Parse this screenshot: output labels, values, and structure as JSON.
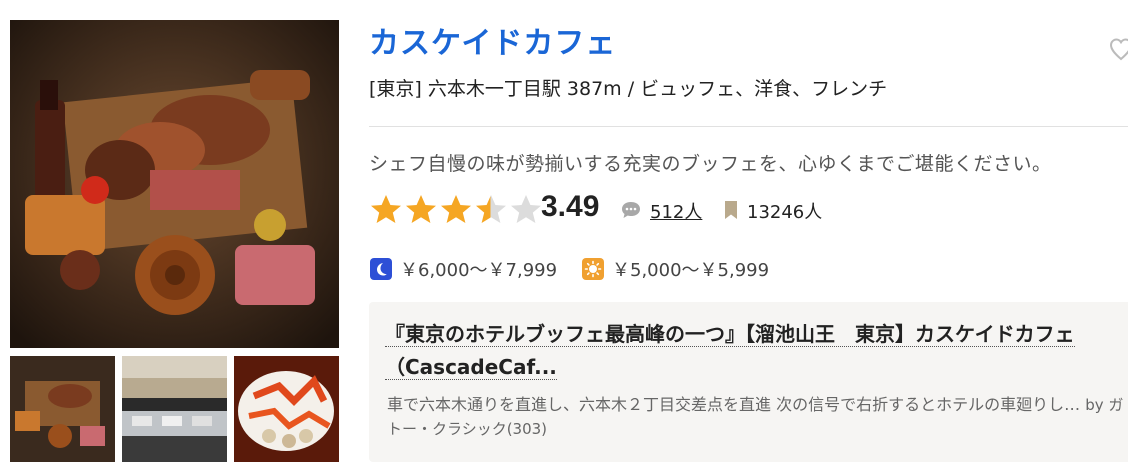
{
  "restaurant": {
    "name": "カスケイドカフェ",
    "meta": "[東京] 六本木一丁目駅 387m / ビュッフェ、洋食、フレンチ",
    "catchcopy": "シェフ自慢の味が勢揃いする充実のブッフェを、心ゆくまでご堪能ください。",
    "rating": {
      "score": "3.49",
      "stars_filled_fraction": 0.698,
      "star_color": "#f5a623"
    },
    "review_count": "512人",
    "bookmark_count": "13246人",
    "prices": {
      "dinner": "￥6,000～￥7,999",
      "lunch": "￥5,000～￥5,999"
    },
    "featured_review": {
      "title": "『東京のホテルブッフェ最高峰の一つ』【溜池山王　東京】カスケイドカフェ（CascadeCaf...",
      "title_line1": "『東京のホテルブッフェ最高峰の一つ』【溜池山王　東京】カスケイドカフェ",
      "title_line2": "（CascadeCaf...",
      "excerpt": "車で六本木通りを直進し、六本木２丁目交差点を直進 次の信号で右折するとホテルの車廻りし…",
      "author": "by ガトー・クラシック(303)"
    }
  },
  "colors": {
    "title_link": "#1a66d6",
    "dinner_icon": "#2d4fd6",
    "lunch_icon": "#f0a030",
    "review_box_bg": "#f6f5f3"
  },
  "icons": {
    "favorite": "heart-outline-icon",
    "review": "speech-bubble-icon",
    "bookmark": "bookmark-icon",
    "dinner": "moon-icon",
    "lunch": "sun-icon"
  }
}
